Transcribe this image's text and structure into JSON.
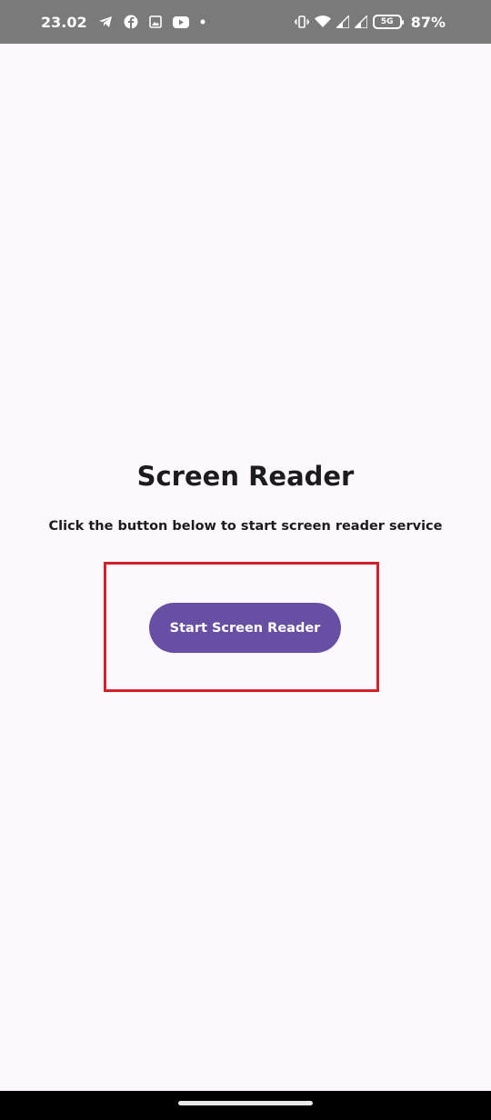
{
  "status_bar": {
    "time": "23.02",
    "battery_percent": "87%",
    "battery_inner": "5G",
    "left_icons": [
      "telegram-icon",
      "facebook-icon",
      "gallery-icon",
      "youtube-icon",
      "dot-icon"
    ],
    "right_icons": [
      "vibrate-icon",
      "wifi-icon",
      "signal-icon",
      "signal-icon",
      "battery-icon"
    ]
  },
  "main": {
    "title": "Screen Reader",
    "subtitle": "Click the button below to start screen reader service",
    "start_button_label": "Start Screen Reader"
  },
  "colors": {
    "background": "#fdf8fd",
    "status_bar": "#7a7a7a",
    "button": "#6750a4",
    "highlight": "#d5202a",
    "nav_bar": "#000000"
  }
}
